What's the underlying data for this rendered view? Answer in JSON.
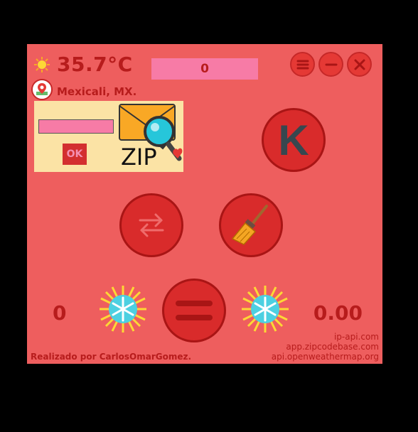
{
  "header": {
    "temperature": "35.7°C",
    "display_value": "0",
    "sun_icon": "sun-icon"
  },
  "window_controls": {
    "menu_icon": "menu-icon",
    "minimize_icon": "minimize-icon",
    "close_icon": "close-icon"
  },
  "location": {
    "icon": "map-pin-icon",
    "text": "Mexicali, MX."
  },
  "zip_panel": {
    "input_value": "",
    "ok_label": "OK",
    "zip_label": "ZIP",
    "icon": "zip-search-envelope-icon"
  },
  "buttons": {
    "k_label": "K",
    "swap_icon": "swap-arrows-icon",
    "broom_icon": "broom-icon",
    "menu_center_icon": "equals-menu-icon"
  },
  "bottom": {
    "left_value": "0",
    "right_value": "0.00",
    "snow_icon": "snow-sun-icon"
  },
  "footer": {
    "credits": "Realizado por CarlosOmarGomez.",
    "api_sources": [
      "ip-api.com",
      "app.zipcodebase.com",
      "api.openweathermap.org"
    ]
  },
  "colors": {
    "background": "#ee5e5e",
    "accent": "#b71c1c",
    "display_bg": "#f77ba6",
    "zip_panel_bg": "#fbe3a5"
  }
}
